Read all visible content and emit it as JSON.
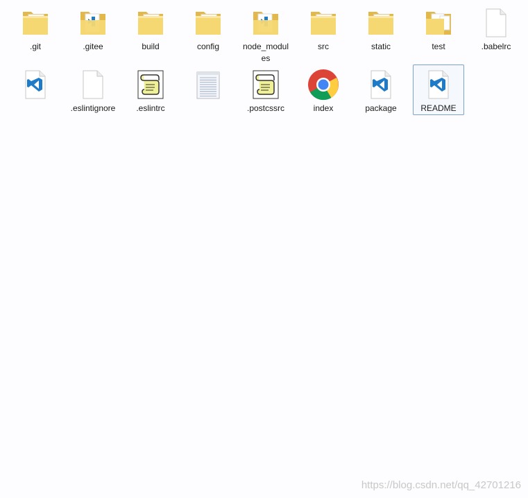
{
  "items": [
    {
      "label": ".git",
      "icon": "folder-icon"
    },
    {
      "label": ".gitee",
      "icon": "folder-with-vscode-files-icon"
    },
    {
      "label": "build",
      "icon": "folder-icon"
    },
    {
      "label": "config",
      "icon": "folder-icon"
    },
    {
      "label": "node_modules",
      "icon": "folder-with-vscode-files-icon"
    },
    {
      "label": "src",
      "icon": "folder-icon"
    },
    {
      "label": "static",
      "icon": "folder-icon"
    },
    {
      "label": "test",
      "icon": "folder-with-files-icon"
    },
    {
      "label": ".babelrc",
      "icon": "blank-file-icon"
    },
    {
      "label": "",
      "icon": "vscode-file-icon"
    },
    {
      "label": ".eslintignore",
      "icon": "blank-file-icon"
    },
    {
      "label": ".eslintrc",
      "icon": "script-file-icon"
    },
    {
      "label": "",
      "icon": "text-file-icon"
    },
    {
      "label": ".postcssrc",
      "icon": "script-file-icon"
    },
    {
      "label": "index",
      "icon": "chrome-icon"
    },
    {
      "label": "package",
      "icon": "vscode-file-icon"
    },
    {
      "label": "README",
      "icon": "vscode-file-icon",
      "selected": true
    }
  ],
  "watermark": "https://blog.csdn.net/qq_42701216",
  "colors": {
    "folder": "#f6d873",
    "folder_dark": "#e2b84a",
    "vscode_blue": "#1f7ac8",
    "selection_border": "#7da2ce"
  }
}
